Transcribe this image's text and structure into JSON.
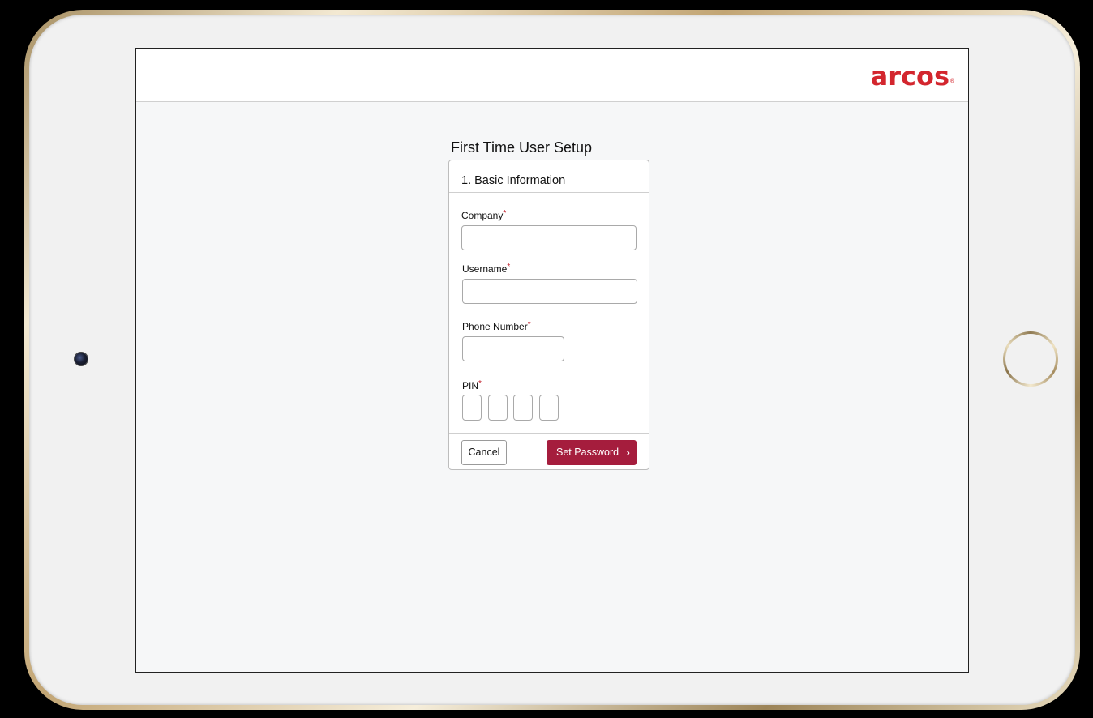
{
  "app": {
    "logo_text": "arcos",
    "logo_mark": "®"
  },
  "page": {
    "title": "First Time User Setup"
  },
  "step": {
    "title": "1. Basic Information"
  },
  "form": {
    "company_label": "Company",
    "username_label": "Username",
    "phone_label": "Phone Number",
    "pin_label": "PIN",
    "required_mark": "*",
    "company_value": "",
    "username_value": "",
    "phone_value": "",
    "pin_digits": [
      "",
      "",
      "",
      ""
    ]
  },
  "actions": {
    "cancel_label": "Cancel",
    "submit_label": "Set Password",
    "submit_icon": "chevron-right-icon",
    "submit_glyph": "›"
  },
  "colors": {
    "brand": "#d3262e",
    "primary_button": "#a51d3d",
    "required": "#c0202c"
  }
}
